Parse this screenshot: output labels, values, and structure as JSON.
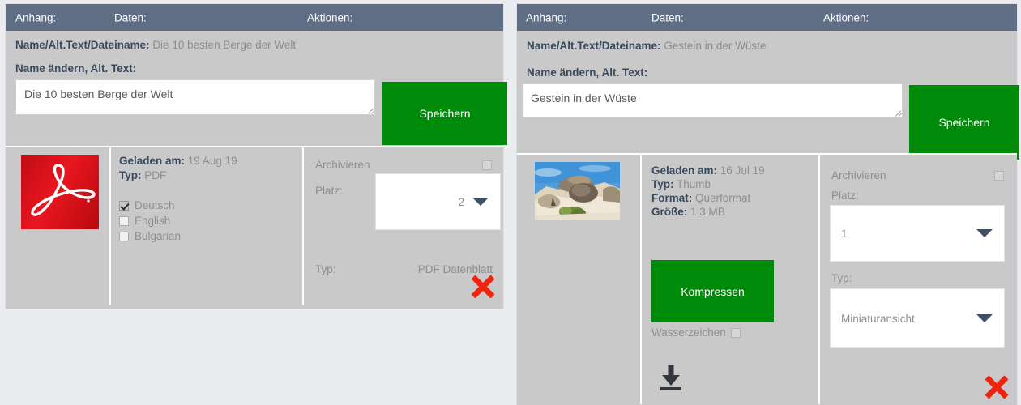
{
  "left_panel": {
    "header": {
      "attachment": "Anhang:",
      "data": "Daten:",
      "actions": "Aktionen:"
    },
    "name_row": {
      "label": "Name/Alt.Text/Dateiname:",
      "value": "Die 10 besten Berge der Welt"
    },
    "edit_label": "Name ändern, Alt. Text:",
    "textarea_value": "Die 10 besten Berge der Welt",
    "textarea_placeholder": "Name ändern, Alt. Text",
    "save_label": "Speichern",
    "thumbnail": {
      "icon": "pdf-acrobat-icon",
      "alt": "PDF"
    },
    "meta": [
      {
        "label": "Geladen am:",
        "value": "19 Aug 19"
      },
      {
        "label": "Typ:",
        "value": "PDF"
      }
    ],
    "languages": [
      {
        "label": "Deutsch",
        "checked": true
      },
      {
        "label": "English",
        "checked": false
      },
      {
        "label": "Bulgarian",
        "checked": false
      }
    ],
    "actions": {
      "archive_label": "Archivieren",
      "archive_checked": false,
      "platz_label": "Platz:",
      "platz_value": "2",
      "typ_label": "Typ:",
      "typ_value": "PDF Datenblatt",
      "delete_icon": "red-x-delete-icon"
    }
  },
  "right_panel": {
    "header": {
      "attachment": "Anhang:",
      "data": "Daten:",
      "actions": "Aktionen:"
    },
    "name_row": {
      "label": "Name/Alt.Text/Dateiname:",
      "value": "Gestein in der Wüste"
    },
    "edit_label": "Name ändern, Alt. Text:",
    "textarea_value": "Gestein in der Wüste",
    "textarea_placeholder": "Name ändern, Alt. Text",
    "save_label": "Speichern",
    "thumbnail": {
      "icon": "desert-rock-photo",
      "alt": "Gestein in der Wüste"
    },
    "meta": [
      {
        "label": "Geladen am:",
        "value": "16 Jul 19"
      },
      {
        "label": "Typ:",
        "value": "Thumb"
      },
      {
        "label": "Format:",
        "value": "Querformat"
      },
      {
        "label": "Größe:",
        "value": "1,3 MB"
      }
    ],
    "compress_label": "Kompressen",
    "watermark_label": "Wasserzeichen",
    "watermark_checked": false,
    "download_icon": "download-arrow-icon",
    "actions": {
      "archive_label": "Archivieren",
      "archive_checked": false,
      "platz_label": "Platz:",
      "platz_value": "1",
      "typ_label": "Typ:",
      "typ_value": "Miniaturansicht",
      "delete_icon": "red-x-delete-icon"
    }
  },
  "colors": {
    "header_bar": "#5f6e85",
    "panel_bg": "#c9c9c9",
    "page_bg": "#eaecf0",
    "button_green": "#008a09",
    "delete_red": "#ee2411",
    "label_dark": "#3a4a5e",
    "value_gray": "#8e8e8e"
  }
}
